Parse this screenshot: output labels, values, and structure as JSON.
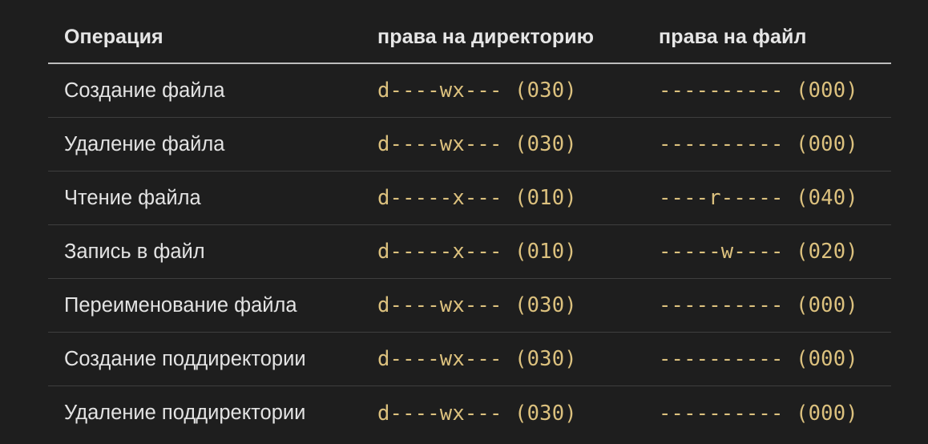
{
  "header": {
    "col_operation": "Операция",
    "col_dir": "права на директорию",
    "col_file": "права на файл"
  },
  "rows": [
    {
      "op": "Создание файла",
      "dir": "d----wx--- (030)",
      "file": "---------- (000)"
    },
    {
      "op": "Удаление файла",
      "dir": "d----wx--- (030)",
      "file": "---------- (000)"
    },
    {
      "op": "Чтение файла",
      "dir": "d-----x--- (010)",
      "file": "----r----- (040)"
    },
    {
      "op": "Запись в файл",
      "dir": "d-----x--- (010)",
      "file": "-----w---- (020)"
    },
    {
      "op": "Переименование файла",
      "dir": "d----wx--- (030)",
      "file": "---------- (000)"
    },
    {
      "op": "Создание поддиректории",
      "dir": "d----wx--- (030)",
      "file": "---------- (000)"
    },
    {
      "op": "Удаление поддиректории",
      "dir": "d----wx--- (030)",
      "file": "---------- (000)"
    }
  ],
  "colors": {
    "background": "#1e1e1e",
    "code": "#dcc17e",
    "text": "#e3e3e3"
  }
}
